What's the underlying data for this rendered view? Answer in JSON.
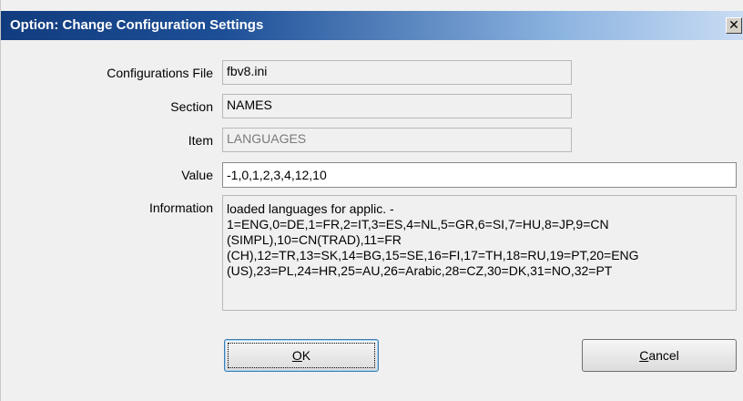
{
  "dialog": {
    "title": "Option: Change Configuration Settings",
    "close_glyph": "✕"
  },
  "fields": {
    "config_file": {
      "label": "Configurations File",
      "value": "fbv8.ini"
    },
    "section": {
      "label": "Section",
      "value": "NAMES"
    },
    "item": {
      "label": "Item",
      "value": "LANGUAGES"
    },
    "value": {
      "label": "Value",
      "value": "-1,0,1,2,3,4,12,10"
    },
    "information": {
      "label": "Information",
      "text": "loaded languages for applic. -\n1=ENG,0=DE,1=FR,2=IT,3=ES,4=NL,5=GR,6=SI,7=HU,8=JP,9=CN\n(SIMPL),10=CN(TRAD),11=FR\n(CH),12=TR,13=SK,14=BG,15=SE,16=FI,17=TH,18=RU,19=PT,20=ENG\n(US),23=PL,24=HR,25=AU,26=Arabic,28=CZ,30=DK,31=NO,32=PT"
    }
  },
  "buttons": {
    "ok": {
      "mnemonic": "O",
      "rest": "K"
    },
    "cancel": {
      "mnemonic": "C",
      "rest": "ancel"
    }
  }
}
